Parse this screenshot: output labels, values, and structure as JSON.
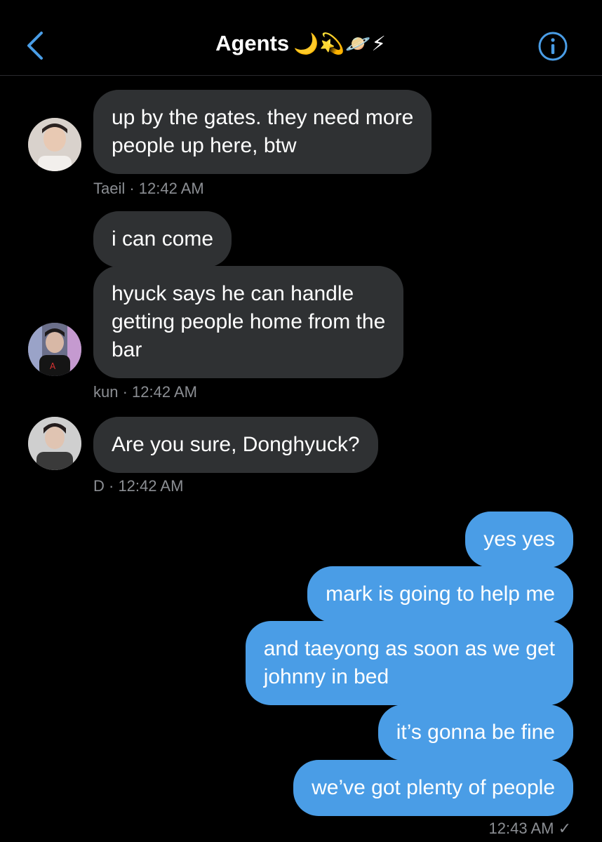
{
  "header": {
    "back_icon": "chevron-left-icon",
    "title": "Agents",
    "title_emojis": "🌙💫🪐⚡",
    "info_icon": "info-icon",
    "accent": "#4a9de6"
  },
  "messages": [
    {
      "sender": "Taeil",
      "text_lines": [
        "up by the gates. they need more",
        "people up here, btw"
      ],
      "meta": "Taeil · 12:42 AM"
    },
    {
      "sender": "kun",
      "text": "i can come"
    },
    {
      "sender": "kun",
      "text_lines": [
        "hyuck says he can handle",
        "getting people home from the",
        "bar"
      ],
      "meta": "kun · 12:42 AM"
    },
    {
      "sender": "D",
      "text": "Are you sure, Donghyuck?",
      "meta": "D · 12:42 AM"
    }
  ],
  "outgoing": [
    {
      "text": "yes yes"
    },
    {
      "text": "mark is going to help me"
    },
    {
      "text_lines": [
        "and taeyong as soon as we get",
        "johnny in bed"
      ]
    },
    {
      "text": "it’s gonna be fine"
    },
    {
      "text": "we’ve got plenty of people"
    }
  ],
  "outgoing_meta": "12:43 AM ✓",
  "colors": {
    "incoming_bubble": "#2f3133",
    "outgoing_bubble": "#4a9de6",
    "background": "#000000",
    "meta_text": "#8b8e93"
  }
}
